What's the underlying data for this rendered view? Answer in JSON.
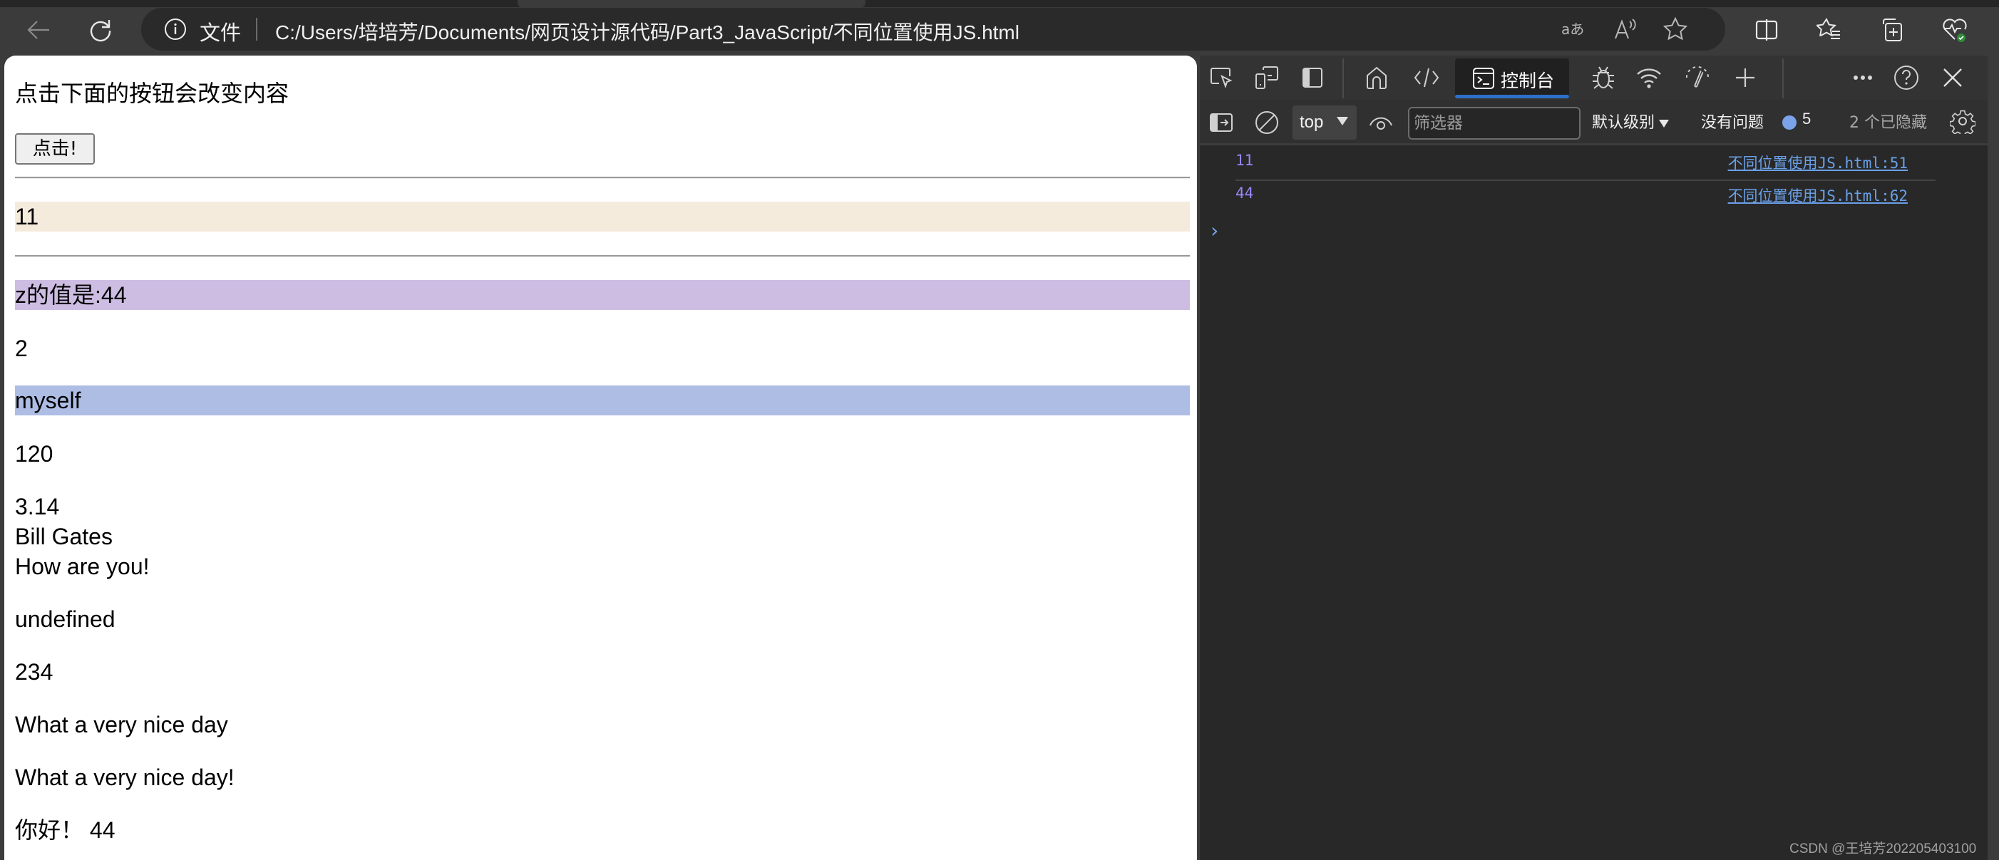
{
  "browser": {
    "back_icon": "arrow-left-icon",
    "reload_icon": "refresh-icon",
    "address_bar": {
      "security_icon": "info-circle-icon",
      "security_label": "文件",
      "url": "C:/Users/培培芳/Documents/网页设计源代码/Part3_JavaScript/不同位置使用JS.html",
      "icons": [
        "translate-icon",
        "read-aloud-icon",
        "favorite-star-icon"
      ]
    },
    "toolbar_icons": [
      "split-screen-icon",
      "favorites-icon",
      "collections-icon",
      "browser-essentials-icon"
    ],
    "colors": {
      "chrome_bg": "#3b3b3b",
      "address_bg": "#2a2a2a",
      "essentials_badge": "#2e8b3a"
    }
  },
  "page": {
    "intro": "点击下面的按钮会改变内容",
    "button_label": "点击!",
    "lines": {
      "x_value": "11",
      "z_value": "z的值是:44",
      "two": "2",
      "myself": "myself",
      "one_twenty": "120",
      "pi": "3.14",
      "name": "Bill Gates",
      "greeting": "How are you!",
      "undefined": "undefined",
      "n234": "234",
      "nice_day": "What a very nice day",
      "nice_day_excl": "What a very nice day!",
      "nihao": "你好！ 44"
    },
    "colors": {
      "band_x": "#f5ebdc",
      "band_z": "#cdbde2",
      "band_myself": "#adbde4"
    }
  },
  "devtools": {
    "toolbar": {
      "left_icons": [
        "inspect-element-icon",
        "device-emulation-icon",
        "toggle-drawer-icon"
      ],
      "tabs": [
        {
          "icon": "welcome-home-icon"
        },
        {
          "icon": "elements-code-icon"
        },
        {
          "icon": "console-icon",
          "label": "控制台",
          "active": true
        },
        {
          "icon": "sources-bug-icon"
        },
        {
          "icon": "network-wifi-icon"
        },
        {
          "icon": "performance-gauge-icon"
        },
        {
          "icon": "more-tools-plus-icon"
        }
      ],
      "right_icons": [
        "more-options-icon",
        "help-icon",
        "close-icon"
      ],
      "active_color": "#2f6fc8"
    },
    "console_toolbar": {
      "sidebar_icon": "show-sidebar-icon",
      "clear_icon": "clear-console-icon",
      "context": "top",
      "eye_icon": "live-expression-eye-icon",
      "filter_placeholder": "筛选器",
      "levels_label": "默认级别",
      "issues_label": "没有问题",
      "issue_count": "5",
      "hidden_label": "2 个已隐藏",
      "settings_icon": "settings-gear-icon"
    },
    "console": {
      "messages": [
        {
          "value": "11",
          "source": "不同位置使用JS.html:51"
        },
        {
          "value": "44",
          "source": "不同位置使用JS.html:62"
        }
      ],
      "prompt_icon": "prompt-chevron-icon",
      "prompt": "›"
    }
  },
  "watermark": "CSDN @王培芳202205403100"
}
